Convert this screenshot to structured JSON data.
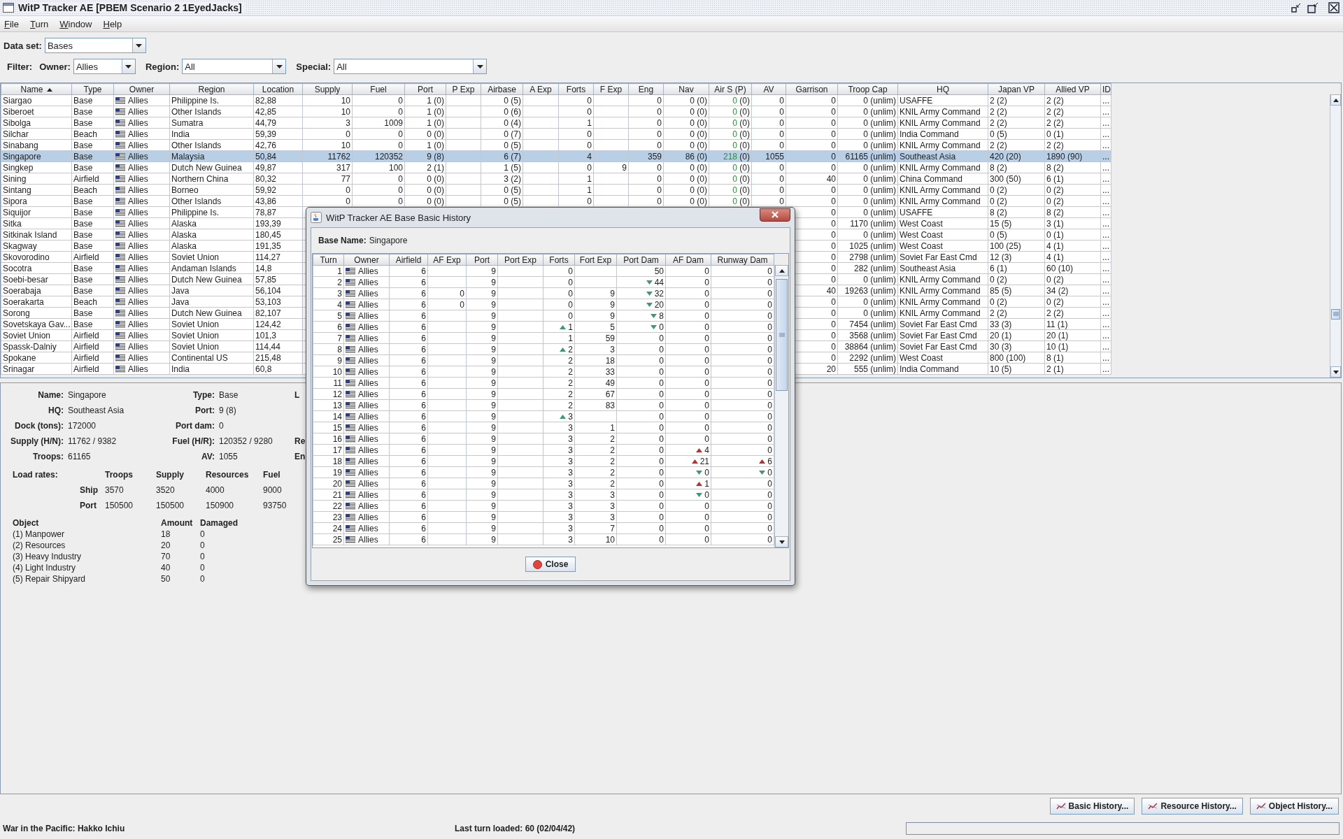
{
  "window": {
    "title": "WitP Tracker AE [PBEM Scenario 2 1EyedJacks]"
  },
  "menu": [
    "File",
    "Turn",
    "Window",
    "Help"
  ],
  "dataset": {
    "label": "Data set:",
    "value": "Bases"
  },
  "filter": {
    "label": "Filter:",
    "fields": [
      {
        "label": "Owner:",
        "value": "Allies"
      },
      {
        "label": "Region:",
        "value": "All"
      },
      {
        "label": "Special:",
        "value": "All"
      }
    ]
  },
  "table": {
    "columns": [
      {
        "label": "Name",
        "sorted": true
      },
      {
        "label": "Type"
      },
      {
        "label": "Owner"
      },
      {
        "label": "Region"
      },
      {
        "label": "Location"
      },
      {
        "label": "Supply"
      },
      {
        "label": "Fuel"
      },
      {
        "label": "Port"
      },
      {
        "label": "P Exp"
      },
      {
        "label": "Airbase"
      },
      {
        "label": "A Exp"
      },
      {
        "label": "Forts"
      },
      {
        "label": "F Exp"
      },
      {
        "label": "Eng"
      },
      {
        "label": "Nav"
      },
      {
        "label": "Air S (P)"
      },
      {
        "label": "AV"
      },
      {
        "label": "Garrison"
      },
      {
        "label": "Troop Cap"
      },
      {
        "label": "HQ"
      },
      {
        "label": "Japan VP"
      },
      {
        "label": "Allied VP"
      },
      {
        "label": "ID"
      }
    ],
    "rows": [
      {
        "selected": false,
        "cells": [
          "Siargao",
          "Base",
          "Allies",
          "Philippine Is.",
          "82,88",
          "10",
          "0",
          "1 (0)",
          null,
          "0 (5)",
          null,
          "0",
          null,
          "0",
          "0 (0)",
          "0 (0)",
          "0",
          "0",
          "0 (unlim)",
          "USAFFE",
          "2 (2)",
          "2 (2)",
          "..."
        ]
      },
      {
        "selected": false,
        "cells": [
          "Siberoet",
          "Base",
          "Allies",
          "Other Islands",
          "42,85",
          "10",
          "0",
          "1 (0)",
          null,
          "0 (6)",
          null,
          "0",
          null,
          "0",
          "0 (0)",
          "0 (0)",
          "0",
          "0",
          "0 (unlim)",
          "KNIL Army Command",
          "2 (2)",
          "2 (2)",
          "..."
        ]
      },
      {
        "selected": false,
        "cells": [
          "Sibolga",
          "Base",
          "Allies",
          "Sumatra",
          "44,79",
          "3",
          "1009",
          "1 (0)",
          null,
          "0 (4)",
          null,
          "1",
          null,
          "0",
          "0 (0)",
          "0 (0)",
          "0",
          "0",
          "0 (unlim)",
          "KNIL Army Command",
          "2 (2)",
          "2 (2)",
          "..."
        ]
      },
      {
        "selected": false,
        "cells": [
          "Silchar",
          "Beach",
          "Allies",
          "India",
          "59,39",
          "0",
          "0",
          "0 (0)",
          null,
          "0 (7)",
          null,
          "0",
          null,
          "0",
          "0 (0)",
          "0 (0)",
          "0",
          "0",
          "0 (unlim)",
          "India Command",
          "0 (5)",
          "0 (1)",
          "..."
        ]
      },
      {
        "selected": false,
        "cells": [
          "Sinabang",
          "Base",
          "Allies",
          "Other Islands",
          "42,76",
          "10",
          "0",
          "1 (0)",
          null,
          "0 (5)",
          null,
          "0",
          null,
          "0",
          "0 (0)",
          "0 (0)",
          "0",
          "0",
          "0 (unlim)",
          "KNIL Army Command",
          "2 (2)",
          "2 (2)",
          "..."
        ]
      },
      {
        "selected": true,
        "cells": [
          "Singapore",
          "Base",
          "Allies",
          "Malaysia",
          "50,84",
          "11762",
          "120352",
          "9 (8)",
          null,
          "6 (7)",
          null,
          "4",
          null,
          "359",
          "86 (0)",
          "218 (0)",
          "1055",
          "0",
          "61165 (unlim)",
          "Southeast Asia",
          "420 (20)",
          "1890 (90)",
          "..."
        ]
      },
      {
        "selected": false,
        "cells": [
          "Singkep",
          "Base",
          "Allies",
          "Dutch New Guinea",
          "49,87",
          "317",
          "100",
          "2 (1)",
          null,
          "1 (5)",
          null,
          "0",
          "9",
          "0",
          "0 (0)",
          "0 (0)",
          "0",
          "0",
          "0 (unlim)",
          "KNIL Army Command",
          "8 (2)",
          "8 (2)",
          "..."
        ]
      },
      {
        "selected": false,
        "cells": [
          "Sining",
          "Airfield",
          "Allies",
          "Northern China",
          "80,32",
          "77",
          "0",
          "0 (0)",
          null,
          "3 (2)",
          null,
          "1",
          null,
          "0",
          "0 (0)",
          "0 (0)",
          "0",
          "40",
          "0 (unlim)",
          "China Command",
          "300 (50)",
          "6 (1)",
          "..."
        ]
      },
      {
        "selected": false,
        "cells": [
          "Sintang",
          "Beach",
          "Allies",
          "Borneo",
          "59,92",
          "0",
          "0",
          "0 (0)",
          null,
          "0 (5)",
          null,
          "1",
          null,
          "0",
          "0 (0)",
          "0 (0)",
          "0",
          "0",
          "0 (unlim)",
          "KNIL Army Command",
          "0 (2)",
          "0 (2)",
          "..."
        ]
      },
      {
        "selected": false,
        "cells": [
          "Sipora",
          "Base",
          "Allies",
          "Other Islands",
          "43,86",
          "0",
          "0",
          "0 (0)",
          null,
          "0 (5)",
          null,
          "0",
          null,
          "0",
          "0 (0)",
          "0 (0)",
          "0",
          "0",
          "0 (unlim)",
          "KNIL Army Command",
          "0 (2)",
          "0 (2)",
          "..."
        ]
      },
      {
        "selected": false,
        "cells": [
          "Siquijor",
          "Base",
          "Allies",
          "Philippine Is.",
          "78,87",
          null,
          null,
          null,
          null,
          null,
          null,
          null,
          null,
          null,
          null,
          null,
          null,
          "0",
          "0 (unlim)",
          "USAFFE",
          "8 (2)",
          "8 (2)",
          "..."
        ]
      },
      {
        "selected": false,
        "cells": [
          "Sitka",
          "Base",
          "Allies",
          "Alaska",
          "193,39",
          null,
          null,
          null,
          null,
          null,
          null,
          null,
          null,
          null,
          null,
          null,
          null,
          "0",
          "1170 (unlim)",
          "West Coast",
          "15 (5)",
          "3 (1)",
          "..."
        ]
      },
      {
        "selected": false,
        "cells": [
          "Sitkinak Island",
          "Base",
          "Allies",
          "Alaska",
          "180,45",
          null,
          null,
          null,
          null,
          null,
          null,
          null,
          null,
          null,
          null,
          null,
          null,
          "0",
          "0 (unlim)",
          "West Coast",
          "0 (5)",
          "0 (1)",
          "..."
        ]
      },
      {
        "selected": false,
        "cells": [
          "Skagway",
          "Base",
          "Allies",
          "Alaska",
          "191,35",
          null,
          null,
          null,
          null,
          null,
          null,
          null,
          null,
          null,
          null,
          null,
          null,
          "0",
          "1025 (unlim)",
          "West Coast",
          "100 (25)",
          "4 (1)",
          "..."
        ]
      },
      {
        "selected": false,
        "cells": [
          "Skovorodino",
          "Airfield",
          "Allies",
          "Soviet Union",
          "114,27",
          null,
          null,
          null,
          null,
          null,
          null,
          null,
          null,
          null,
          null,
          null,
          null,
          "0",
          "2798 (unlim)",
          "Soviet Far East Cmd",
          "12 (3)",
          "4 (1)",
          "..."
        ]
      },
      {
        "selected": false,
        "cells": [
          "Socotra",
          "Base",
          "Allies",
          "Andaman Islands",
          "14,8",
          null,
          null,
          null,
          null,
          null,
          null,
          null,
          null,
          null,
          null,
          null,
          null,
          "0",
          "282 (unlim)",
          "Southeast Asia",
          "6 (1)",
          "60 (10)",
          "..."
        ]
      },
      {
        "selected": false,
        "cells": [
          "Soebi-besar",
          "Base",
          "Allies",
          "Dutch New Guinea",
          "57,85",
          null,
          null,
          null,
          null,
          null,
          null,
          null,
          null,
          null,
          null,
          null,
          null,
          "0",
          "0 (unlim)",
          "KNIL Army Command",
          "0 (2)",
          "0 (2)",
          "..."
        ]
      },
      {
        "selected": false,
        "cells": [
          "Soerabaja",
          "Base",
          "Allies",
          "Java",
          "56,104",
          null,
          null,
          null,
          null,
          null,
          null,
          null,
          null,
          null,
          null,
          null,
          null,
          "40",
          "19263 (unlim)",
          "KNIL Army Command",
          "85 (5)",
          "34 (2)",
          "..."
        ]
      },
      {
        "selected": false,
        "cells": [
          "Soerakarta",
          "Beach",
          "Allies",
          "Java",
          "53,103",
          null,
          null,
          null,
          null,
          null,
          null,
          null,
          null,
          null,
          null,
          null,
          null,
          "0",
          "0 (unlim)",
          "KNIL Army Command",
          "0 (2)",
          "0 (2)",
          "..."
        ]
      },
      {
        "selected": false,
        "cells": [
          "Sorong",
          "Base",
          "Allies",
          "Dutch New Guinea",
          "82,107",
          null,
          null,
          null,
          null,
          null,
          null,
          null,
          null,
          null,
          null,
          null,
          null,
          "0",
          "0 (unlim)",
          "KNIL Army Command",
          "2 (2)",
          "2 (2)",
          "..."
        ]
      },
      {
        "selected": false,
        "cells": [
          "Sovetskaya Gav...",
          "Base",
          "Allies",
          "Soviet Union",
          "124,42",
          null,
          null,
          null,
          null,
          null,
          null,
          null,
          null,
          null,
          null,
          null,
          null,
          "0",
          "7454 (unlim)",
          "Soviet Far East Cmd",
          "33 (3)",
          "11 (1)",
          "..."
        ]
      },
      {
        "selected": false,
        "cells": [
          "Soviet Union",
          "Airfield",
          "Allies",
          "Soviet Union",
          "101,3",
          null,
          null,
          null,
          null,
          null,
          null,
          null,
          null,
          null,
          null,
          null,
          null,
          "0",
          "3568 (unlim)",
          "Soviet Far East Cmd",
          "20 (1)",
          "20 (1)",
          "..."
        ]
      },
      {
        "selected": false,
        "cells": [
          "Spassk-Dalniy",
          "Airfield",
          "Allies",
          "Soviet Union",
          "114,44",
          null,
          null,
          null,
          null,
          null,
          null,
          null,
          null,
          null,
          null,
          null,
          null,
          "0",
          "38864 (unlim)",
          "Soviet Far East Cmd",
          "30 (3)",
          "10 (1)",
          "..."
        ]
      },
      {
        "selected": false,
        "cells": [
          "Spokane",
          "Airfield",
          "Allies",
          "Continental US",
          "215,48",
          null,
          null,
          null,
          null,
          null,
          null,
          null,
          null,
          null,
          null,
          null,
          null,
          "0",
          "2292 (unlim)",
          "West Coast",
          "800 (100)",
          "8 (1)",
          "..."
        ]
      },
      {
        "selected": false,
        "cells": [
          "Srinagar",
          "Airfield",
          "Allies",
          "India",
          "60,8",
          null,
          null,
          null,
          null,
          null,
          null,
          null,
          null,
          null,
          null,
          null,
          null,
          "20",
          "555 (unlim)",
          "India Command",
          "10 (5)",
          "2 (1)",
          "..."
        ]
      }
    ]
  },
  "details": {
    "rows": [
      {
        "cells": [
          {
            "label": "Name:",
            "value": "Singapore"
          },
          {
            "label": "Type:",
            "value": "Base"
          },
          {
            "label": "L"
          }
        ]
      },
      {
        "cells": [
          {
            "label": "HQ:",
            "value": "Southeast Asia"
          },
          {
            "label": "Port:",
            "value": "9 (8)"
          }
        ]
      },
      {
        "cells": [
          {
            "label": "Dock (tons):",
            "value": "172000"
          },
          {
            "label": "Port dam:",
            "value": "0"
          }
        ]
      },
      {
        "cells": [
          {
            "label": "Supply (H/N):",
            "value": "11762 / 9382"
          },
          {
            "label": "Fuel (H/R):",
            "value": "120352 / 9280"
          },
          {
            "label": "Re"
          }
        ]
      },
      {
        "cells": [
          {
            "label": "Troops:",
            "value": "61165"
          },
          {
            "label": "AV:",
            "value": "1055"
          },
          {
            "label": "En"
          }
        ]
      }
    ],
    "load_rates": {
      "label": "Load rates:",
      "columns": [
        "Troops",
        "Supply",
        "Resources",
        "Fuel"
      ],
      "rows": [
        {
          "label": "Ship",
          "values": [
            "3570",
            "3520",
            "4000",
            "9000"
          ]
        },
        {
          "label": "Port",
          "values": [
            "150500",
            "150500",
            "150900",
            "93750"
          ]
        }
      ]
    },
    "objects": {
      "columns": [
        "Object",
        "Amount",
        "Damaged"
      ],
      "rows": [
        [
          "(1) Manpower",
          "18",
          "0"
        ],
        [
          "(2) Resources",
          "20",
          "0"
        ],
        [
          "(3) Heavy Industry",
          "70",
          "0"
        ],
        [
          "(4) Light Industry",
          "40",
          "0"
        ],
        [
          "(5) Repair Shipyard",
          "50",
          "0"
        ]
      ]
    }
  },
  "buttons": [
    "Basic History...",
    "Resource History...",
    "Object History..."
  ],
  "status": {
    "left": "War in the Pacific: Hakko Ichiu",
    "center": "Last turn loaded: 60 (02/04/42)",
    "progress": {
      "level": 0
    }
  },
  "dialog": {
    "title": "WitP Tracker AE Base Basic History",
    "base_name_label": "Base Name:",
    "base_name": "Singapore",
    "columns": [
      "Turn",
      "Owner",
      "Airfield",
      "AF Exp",
      "Port",
      "Port Exp",
      "Forts",
      "Fort Exp",
      "Port Dam",
      "AF Dam",
      "Runway Dam"
    ],
    "rows": [
      [
        "1",
        "Allies",
        "6",
        null,
        "9",
        null,
        "0",
        null,
        "50",
        "0",
        "0"
      ],
      [
        "2",
        "Allies",
        "6",
        null,
        "9",
        null,
        "0",
        null,
        {
          "text": "44",
          "up": false,
          "color": "#3d9a70"
        },
        "0",
        "0"
      ],
      [
        "3",
        "Allies",
        "6",
        "0",
        "9",
        null,
        "0",
        "9",
        {
          "text": "32",
          "up": false,
          "color": "#3d9a70"
        },
        "0",
        "0"
      ],
      [
        "4",
        "Allies",
        "6",
        "0",
        "9",
        null,
        "0",
        "9",
        {
          "text": "20",
          "up": false,
          "color": "#3d9a70"
        },
        "0",
        "0"
      ],
      [
        "5",
        "Allies",
        "6",
        null,
        "9",
        null,
        "0",
        "9",
        {
          "text": "8",
          "up": false,
          "color": "#3d9a70"
        },
        "0",
        "0"
      ],
      [
        "6",
        "Allies",
        "6",
        null,
        "9",
        null,
        {
          "text": "1",
          "up": true,
          "color": "#3d9a70"
        },
        "5",
        {
          "text": "0",
          "up": false,
          "color": "#3d9a70"
        },
        "0",
        "0"
      ],
      [
        "7",
        "Allies",
        "6",
        null,
        "9",
        null,
        "1",
        "59",
        "0",
        "0",
        "0"
      ],
      [
        "8",
        "Allies",
        "6",
        null,
        "9",
        null,
        {
          "text": "2",
          "up": true,
          "color": "#3d9a70"
        },
        "3",
        "0",
        "0",
        "0"
      ],
      [
        "9",
        "Allies",
        "6",
        null,
        "9",
        null,
        "2",
        "18",
        "0",
        "0",
        "0"
      ],
      [
        "10",
        "Allies",
        "6",
        null,
        "9",
        null,
        "2",
        "33",
        "0",
        "0",
        "0"
      ],
      [
        "11",
        "Allies",
        "6",
        null,
        "9",
        null,
        "2",
        "49",
        "0",
        "0",
        "0"
      ],
      [
        "12",
        "Allies",
        "6",
        null,
        "9",
        null,
        "2",
        "67",
        "0",
        "0",
        "0"
      ],
      [
        "13",
        "Allies",
        "6",
        null,
        "9",
        null,
        "2",
        "83",
        "0",
        "0",
        "0"
      ],
      [
        "14",
        "Allies",
        "6",
        null,
        "9",
        null,
        {
          "text": "3",
          "up": true,
          "color": "#3d9a70"
        },
        null,
        "0",
        "0",
        "0"
      ],
      [
        "15",
        "Allies",
        "6",
        null,
        "9",
        null,
        "3",
        "1",
        "0",
        "0",
        "0"
      ],
      [
        "16",
        "Allies",
        "6",
        null,
        "9",
        null,
        "3",
        "2",
        "0",
        "0",
        "0"
      ],
      [
        "17",
        "Allies",
        "6",
        null,
        "9",
        null,
        "3",
        "2",
        "0",
        {
          "text": "4",
          "up": true,
          "color": "#b03434"
        },
        "0"
      ],
      [
        "18",
        "Allies",
        "6",
        null,
        "9",
        null,
        "3",
        "2",
        "0",
        {
          "text": "21",
          "up": true,
          "color": "#b03434"
        },
        {
          "text": "6",
          "up": true,
          "color": "#b03434"
        }
      ],
      [
        "19",
        "Allies",
        "6",
        null,
        "9",
        null,
        "3",
        "2",
        "0",
        {
          "text": "0",
          "up": false,
          "color": "#3d9a70"
        },
        {
          "text": "0",
          "up": false,
          "color": "#3d9a70"
        }
      ],
      [
        "20",
        "Allies",
        "6",
        null,
        "9",
        null,
        "3",
        "2",
        "0",
        {
          "text": "1",
          "up": true,
          "color": "#b03434"
        },
        "0"
      ],
      [
        "21",
        "Allies",
        "6",
        null,
        "9",
        null,
        "3",
        "3",
        "0",
        {
          "text": "0",
          "up": false,
          "color": "#3d9a70"
        },
        "0"
      ],
      [
        "22",
        "Allies",
        "6",
        null,
        "9",
        null,
        "3",
        "3",
        "0",
        "0",
        "0"
      ],
      [
        "23",
        "Allies",
        "6",
        null,
        "9",
        null,
        "3",
        "3",
        "0",
        "0",
        "0"
      ],
      [
        "24",
        "Allies",
        "6",
        null,
        "9",
        null,
        "3",
        "7",
        "0",
        "0",
        "0"
      ],
      [
        "25",
        "Allies",
        "6",
        null,
        "9",
        null,
        "3",
        "10",
        "0",
        "0",
        "0"
      ]
    ],
    "close": "Close"
  }
}
